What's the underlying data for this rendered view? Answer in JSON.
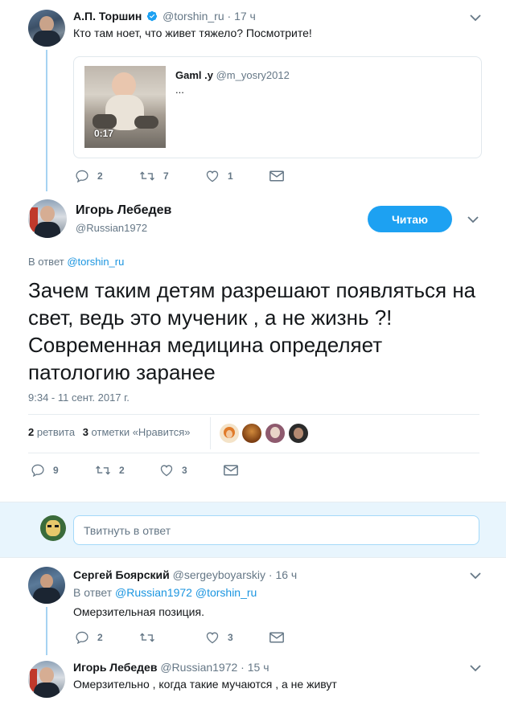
{
  "tweet1": {
    "author_name": "А.П. Торшин",
    "handle": "@torshin_ru",
    "time": "17 ч",
    "text": "Кто там ноет, что живет тяжело? Посмотрите!",
    "quoted": {
      "author_name": "Gaml .y",
      "handle": "@m_yosry2012",
      "text": "...",
      "video_duration": "0:17"
    },
    "replies": "2",
    "retweets": "7",
    "likes": "1"
  },
  "main_tweet": {
    "author_name": "Игорь Лебедев",
    "handle": "@Russian1972",
    "follow_label": "Читаю",
    "reply_prefix": "В ответ",
    "reply_to": "@torshin_ru",
    "text": "Зачем таким детям разрешают появляться на свет, ведь это мученик , а не жизнь ?! Современная медицина определяет патологию заранее",
    "timestamp": "9:34 - 11 сент. 2017 г.",
    "retweets_count": "2",
    "retweets_label": "ретвита",
    "likes_count": "3",
    "likes_label": "отметки «Нравится»",
    "replies": "9",
    "retweets": "2",
    "likes": "3"
  },
  "reply_box": {
    "placeholder": "Твитнуть в ответ"
  },
  "reply1": {
    "author_name": "Сергей Боярский",
    "handle": "@sergeyboyarskiy",
    "time": "16 ч",
    "reply_prefix": "В ответ",
    "reply_to_1": "@Russian1972",
    "reply_to_2": "@torshin_ru",
    "text": "Омерзительная позиция.",
    "replies": "2",
    "retweets": "",
    "likes": "3"
  },
  "reply2": {
    "author_name": "Игорь Лебедев",
    "handle": "@Russian1972",
    "time": "15 ч",
    "text": "Омерзительно , когда такие мучаются , а не живут"
  },
  "colors": {
    "accent": "#1da1f2",
    "link": "#1b95e0",
    "muted": "#657786",
    "thread_line": "#a6d3f2"
  }
}
